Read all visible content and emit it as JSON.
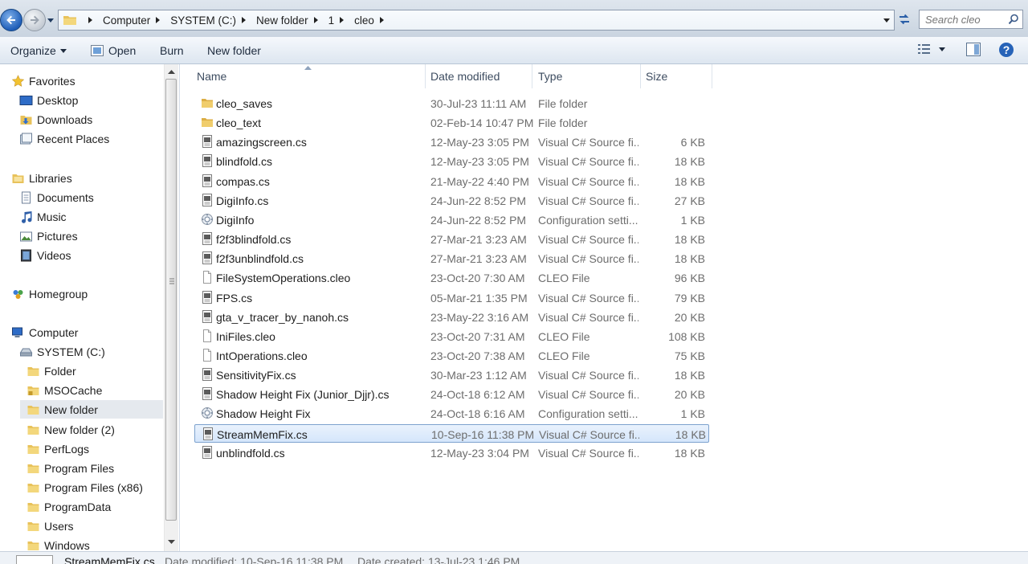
{
  "address": {
    "breadcrumbs": [
      "Computer",
      "SYSTEM (C:)",
      "New folder",
      "1",
      "cleo"
    ],
    "search_placeholder": "Search cleo"
  },
  "toolbar": {
    "organize": "Organize",
    "open": "Open",
    "burn": "Burn",
    "new_folder": "New folder"
  },
  "nav": {
    "favorites": "Favorites",
    "desktop": "Desktop",
    "downloads": "Downloads",
    "recent_places": "Recent Places",
    "libraries": "Libraries",
    "documents": "Documents",
    "music": "Music",
    "pictures": "Pictures",
    "videos": "Videos",
    "homegroup": "Homegroup",
    "computer": "Computer",
    "system_c": "SYSTEM (C:)",
    "folders": [
      "Folder",
      "MSOCache",
      "New folder",
      "New folder (2)",
      "PerfLogs",
      "Program Files",
      "Program Files (x86)",
      "ProgramData",
      "Users",
      "Windows"
    ]
  },
  "columns": {
    "name": "Name",
    "date": "Date modified",
    "type": "Type",
    "size": "Size"
  },
  "files": [
    {
      "name": "cleo_saves",
      "date": "30-Jul-23 11:11 AM",
      "type": "File folder",
      "size": "",
      "icon": "folder-icon"
    },
    {
      "name": "cleo_text",
      "date": "02-Feb-14 10:47 PM",
      "type": "File folder",
      "size": "",
      "icon": "folder-icon"
    },
    {
      "name": "amazingscreen.cs",
      "date": "12-May-23 3:05 PM",
      "type": "Visual C# Source fi...",
      "size": "6 KB",
      "icon": "csharp-file-icon"
    },
    {
      "name": "blindfold.cs",
      "date": "12-May-23 3:05 PM",
      "type": "Visual C# Source fi...",
      "size": "18 KB",
      "icon": "csharp-file-icon"
    },
    {
      "name": "compas.cs",
      "date": "21-May-22 4:40 PM",
      "type": "Visual C# Source fi...",
      "size": "18 KB",
      "icon": "csharp-file-icon"
    },
    {
      "name": "DigiInfo.cs",
      "date": "24-Jun-22 8:52 PM",
      "type": "Visual C# Source fi...",
      "size": "27 KB",
      "icon": "csharp-file-icon"
    },
    {
      "name": "DigiInfo",
      "date": "24-Jun-22 8:52 PM",
      "type": "Configuration setti...",
      "size": "1 KB",
      "icon": "config-file-icon"
    },
    {
      "name": "f2f3blindfold.cs",
      "date": "27-Mar-21 3:23 AM",
      "type": "Visual C# Source fi...",
      "size": "18 KB",
      "icon": "csharp-file-icon"
    },
    {
      "name": "f2f3unblindfold.cs",
      "date": "27-Mar-21 3:23 AM",
      "type": "Visual C# Source fi...",
      "size": "18 KB",
      "icon": "csharp-file-icon"
    },
    {
      "name": "FileSystemOperations.cleo",
      "date": "23-Oct-20 7:30 AM",
      "type": "CLEO File",
      "size": "96 KB",
      "icon": "blank-file-icon"
    },
    {
      "name": "FPS.cs",
      "date": "05-Mar-21 1:35 PM",
      "type": "Visual C# Source fi...",
      "size": "79 KB",
      "icon": "csharp-file-icon"
    },
    {
      "name": "gta_v_tracer_by_nanoh.cs",
      "date": "23-May-22 3:16 AM",
      "type": "Visual C# Source fi...",
      "size": "20 KB",
      "icon": "csharp-file-icon"
    },
    {
      "name": "IniFiles.cleo",
      "date": "23-Oct-20 7:31 AM",
      "type": "CLEO File",
      "size": "108 KB",
      "icon": "blank-file-icon"
    },
    {
      "name": "IntOperations.cleo",
      "date": "23-Oct-20 7:38 AM",
      "type": "CLEO File",
      "size": "75 KB",
      "icon": "blank-file-icon"
    },
    {
      "name": "SensitivityFix.cs",
      "date": "30-Mar-23 1:12 AM",
      "type": "Visual C# Source fi...",
      "size": "18 KB",
      "icon": "csharp-file-icon"
    },
    {
      "name": "Shadow Height Fix (Junior_Djjr).cs",
      "date": "24-Oct-18 6:12 AM",
      "type": "Visual C# Source fi...",
      "size": "20 KB",
      "icon": "csharp-file-icon"
    },
    {
      "name": "Shadow Height Fix",
      "date": "24-Oct-18 6:16 AM",
      "type": "Configuration setti...",
      "size": "1 KB",
      "icon": "config-file-icon"
    },
    {
      "name": "StreamMemFix.cs",
      "date": "10-Sep-16 11:38 PM",
      "type": "Visual C# Source fi...",
      "size": "18 KB",
      "icon": "csharp-file-icon",
      "selected": true
    },
    {
      "name": "unblindfold.cs",
      "date": "12-May-23 3:04 PM",
      "type": "Visual C# Source fi...",
      "size": "18 KB",
      "icon": "csharp-file-icon"
    }
  ],
  "details": {
    "name": "StreamMemFix.cs",
    "modified": "Date modified: 10-Sep-16 11:38 PM",
    "created": "Date created: 13-Jul-23 1:46 PM"
  }
}
